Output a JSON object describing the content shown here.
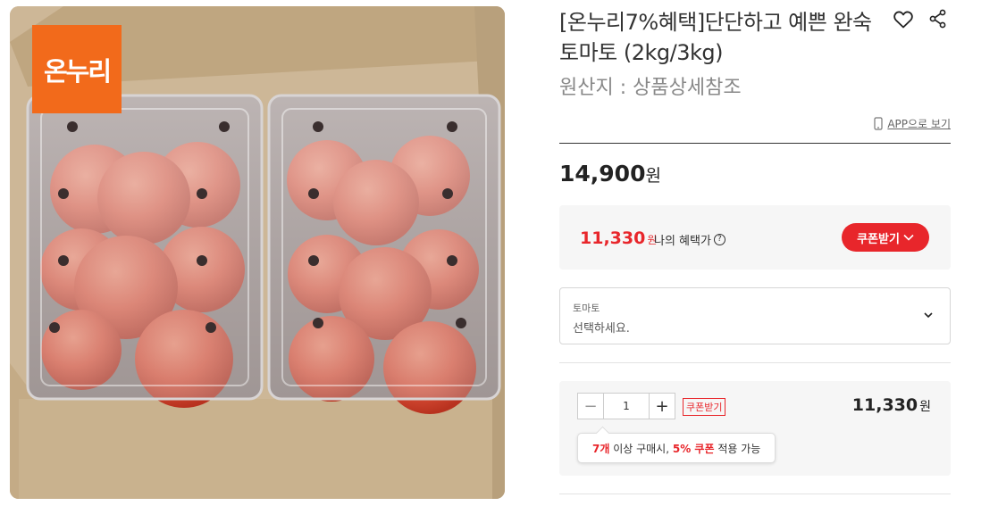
{
  "brand_badge": {
    "text": "온누리"
  },
  "product": {
    "title": "[온누리7%혜택]단단하고 예쁜 완숙토마토 (2kg/3kg)",
    "origin": "원산지 : 상품상세참조",
    "app_view": "APP으로 보기",
    "price": "14,900",
    "price_unit": "원"
  },
  "icons": {
    "heart": "heart-icon",
    "share": "share-icon",
    "phone": "phone-icon",
    "chevron": "chevron-down-icon",
    "help": "question-icon"
  },
  "benefit": {
    "price": "11,330",
    "unit": "원",
    "label": "나의 혜택가",
    "help": "?",
    "coupon_button": "쿠폰받기"
  },
  "option_select": {
    "label": "토마토",
    "placeholder": "선택하세요."
  },
  "order": {
    "minus": "−",
    "quantity": "1",
    "plus": "+",
    "coupon_tag": "쿠폰받기",
    "price": "11,330",
    "unit": "원",
    "tooltip": {
      "qty": "7개",
      "t1": " 이상 구매시, ",
      "pct": "5% 쿠폰",
      "t2": " 적용 가능"
    }
  },
  "colors": {
    "accent": "#e8262b",
    "badge": "#f26a1b"
  }
}
